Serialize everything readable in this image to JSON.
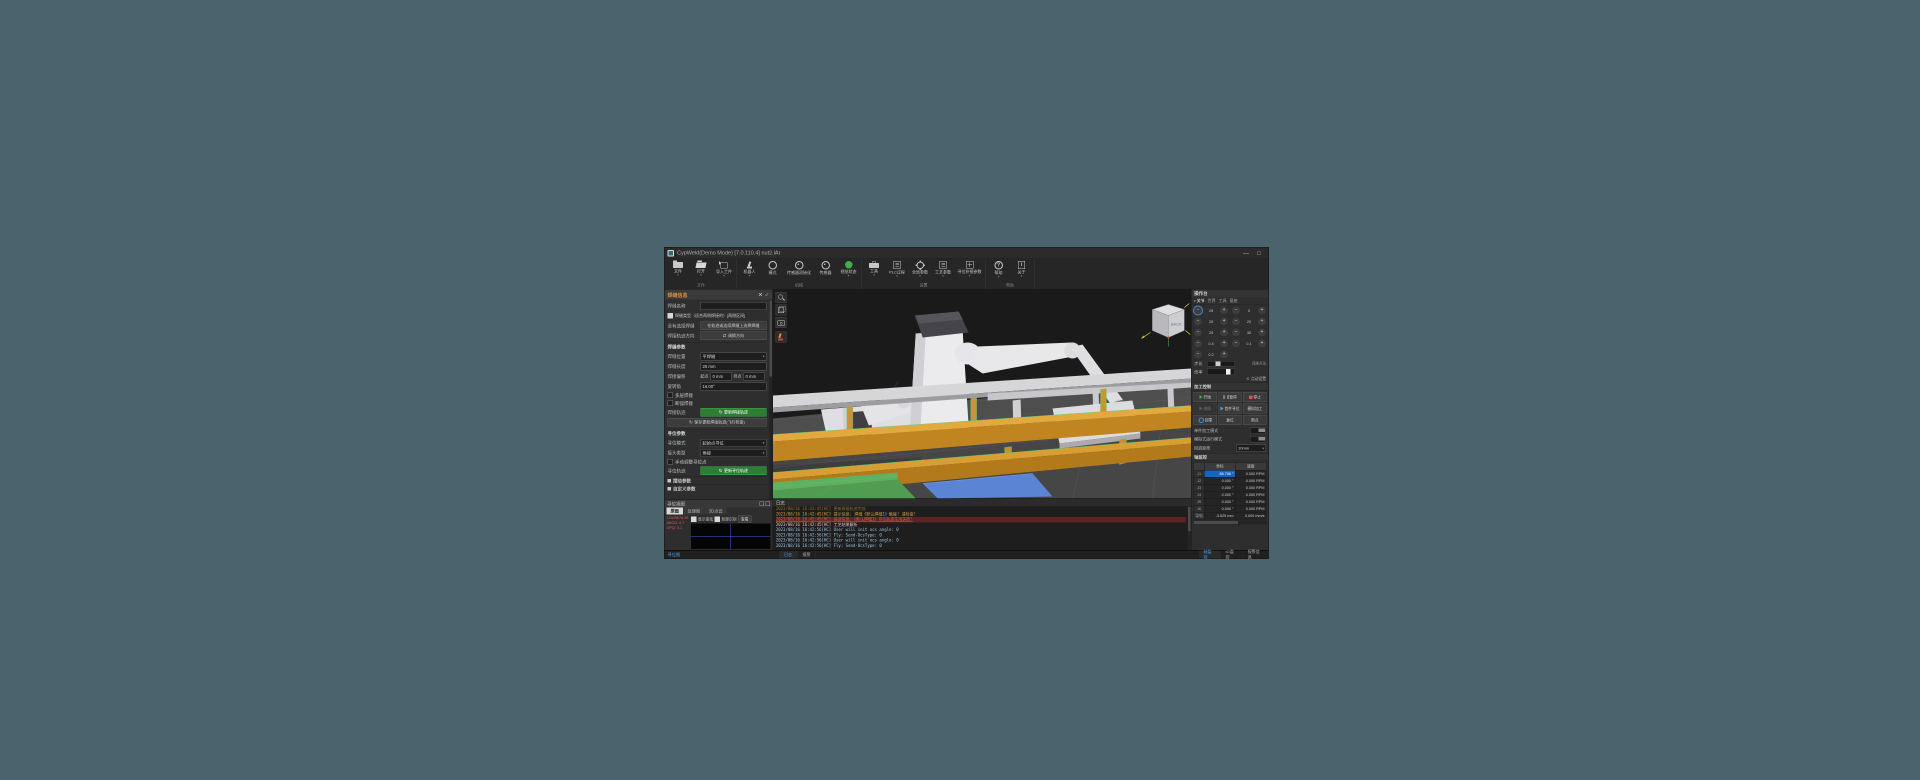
{
  "colors": {
    "desktop_bg": "#4b636d",
    "accent_green": "#3fae4a",
    "stop_red": "#d9534f",
    "panel_header_orange": "#d78d3c",
    "selected_cell_blue": "#1565c0",
    "tab_active_blue": "#4da3ff",
    "log_orange": "#d99b3c",
    "log_red": "#e05a52",
    "log_blue": "#9fc4e0",
    "workpiece_orange": "#c9892b",
    "panel_green": "#4f9c52",
    "panel_blue": "#5c84d4"
  },
  "window": {
    "title": "CypWeld(Demo Mode)  [7.0.110.4]  nut2.lAr",
    "minimize_glyph": "—",
    "maximize_glyph": "□"
  },
  "toolbar": {
    "groups": [
      {
        "label": "文件",
        "items": [
          {
            "label": "文件",
            "icon": "folder",
            "caret": true
          },
          {
            "label": "打开",
            "icon": "open",
            "caret": true
          },
          {
            "label": "导入工件",
            "icon": "import",
            "caret": true
          }
        ]
      },
      {
        "label": "机械",
        "items": [
          {
            "label": "机器人",
            "icon": "robot",
            "caret": true
          },
          {
            "label": "模式",
            "icon": "mode",
            "caret": false
          },
          {
            "label": "传感器初始化",
            "icon": "sensor",
            "caret": false
          },
          {
            "label": "传感器",
            "icon": "sensor2",
            "caret": false
          },
          {
            "label": "视觉状态",
            "icon": "status",
            "caret": true
          }
        ]
      },
      {
        "label": "设置",
        "items": [
          {
            "label": "工具",
            "icon": "case",
            "caret": true
          },
          {
            "label": "PLC过程",
            "icon": "doc",
            "caret": true
          },
          {
            "label": "全局参数",
            "icon": "gear",
            "caret": true
          },
          {
            "label": "工艺参数",
            "icon": "sheet",
            "caret": true
          },
          {
            "label": "寻位补偿参数",
            "icon": "comp",
            "caret": true
          }
        ]
      },
      {
        "label": "帮助",
        "items": [
          {
            "label": "帮助",
            "icon": "help",
            "caret": true
          },
          {
            "label": "关于",
            "icon": "about",
            "caret": true
          }
        ]
      }
    ]
  },
  "seam_panel": {
    "header": "焊缝信息",
    "close_glyph": "✕",
    "confirm_glyph": "✔",
    "name_label": "焊缝名称",
    "name_value": "",
    "type_check_label": "焊缝类型（适合两侧焊接的）[两侧区间]",
    "type_checked": true,
    "select_label": "没有选择焊缝",
    "select_button": "在轨迹或连续焊缝上选择焊缝",
    "dir_label": "焊接轨迹方向",
    "dir_button": "调换方向",
    "swap_glyph": "⇄",
    "sec_weld": "焊缝参数",
    "pos_label": "焊缝位置",
    "pos_value": "平焊缝",
    "len_label": "焊缝长度",
    "len_value": "25 mm",
    "offset_label": "焊接偏移",
    "offset_start_label": "起点",
    "offset_start_value": "0 mm",
    "offset_end_label": "终点",
    "offset_end_value": "0 mm",
    "angle_label": "旋转角",
    "angle_value": "16.00°",
    "chk_multilayer": "多层焊接",
    "chk_arc": "断弧焊接",
    "track_label": "焊接轨迹",
    "track_button": "更新焊接轨迹",
    "wide_button": "保存更新焊接轨迹(飞行检查)",
    "refresh_glyph": "↻",
    "sec_locate": "寻位参数",
    "mode_label": "寻位模式",
    "mode_value": "起始点寻位",
    "joint_label": "接头类型",
    "joint_value": "角接",
    "chk_manual": "手动调整寻位点",
    "locate_label": "寻位轨迹",
    "locate_button": "更新寻位轨迹",
    "collapsed": [
      "摆动参数",
      "自定义参数"
    ]
  },
  "vision_panel": {
    "header": "寻位视图",
    "tabs": {
      "items": [
        "原图",
        "处理图",
        "3D点云"
      ],
      "active": 0
    },
    "red_lines": [
      "12345678.99",
      "ABCD: 4.7",
      "OPQ: 3.1"
    ],
    "chk_show": "显示查找",
    "chk_contour": "轮廓识别",
    "view_button": "查看"
  },
  "viewport": {
    "cube_label": "BACK",
    "tools": [
      "zoom",
      "view-cube",
      "camera",
      "robot-tool"
    ]
  },
  "log_panel": {
    "header": "日志",
    "lines": [
      {
        "text": "2023/08/16 16:42:45[HC] 更新焊接轨迹完成",
        "color": "dimorange",
        "selected": false
      },
      {
        "text": "2023/08/16 16:42:45[HC] 提示信息: 焊缝《默认焊缝1》触碰! 请检查!",
        "color": "orange",
        "selected": false
      },
      {
        "text": "2023/08/16 16:42:45[HC] 错误信息:《默认焊缝1》寻位轨迹生成失败!",
        "color": "red",
        "selected": true
      },
      {
        "text": "2023/08/16 16:42:45[HC] 工艺结果解析",
        "color": "white",
        "selected": false
      },
      {
        "text": "2023/08/16 16:42:56[HC] User will init ocs angle: 0",
        "color": "blue",
        "selected": false
      },
      {
        "text": "2023/08/16 16:42:56[HC] Fly: Send-OcsType: 0",
        "color": "blue",
        "selected": false
      },
      {
        "text": "2023/08/16 16:42:56[HC] User will init ocs angle: 0",
        "color": "blue",
        "selected": false
      },
      {
        "text": "2023/08/16 16:42:56[HC] Fly: Send-OcsType: 0",
        "color": "blue",
        "selected": false
      }
    ]
  },
  "right_panel": {
    "header": "操作台",
    "mode_tabs": {
      "items": [
        "关节",
        "世界",
        "工具",
        "基座"
      ],
      "active": 0
    },
    "jog": {
      "minus": "−",
      "plus": "+",
      "pairs": [
        [
          "25",
          "0"
        ],
        [
          "20",
          "20"
        ],
        [
          "25",
          "30"
        ],
        [
          "0.4",
          "0.1"
        ],
        [
          "0.2",
          null
        ]
      ]
    },
    "step_label": "步长",
    "step_hint": "连续点动",
    "rate_label": "倍率",
    "jog_settings_glyph": "⊙",
    "jog_settings": "点动设置",
    "sec_control": "加工控制",
    "control_rows": [
      [
        {
          "label": "开始",
          "icon": "play",
          "dim": false
        },
        {
          "label": "暂停",
          "icon": "pause",
          "dim": false
        },
        {
          "label": "停止",
          "icon": "stop",
          "dim": false
        }
      ],
      [
        {
          "label": "继续",
          "icon": "play-dim",
          "dim": true
        },
        {
          "label": "首件寻位",
          "icon": "play-blue",
          "dim": false
        },
        {
          "label": "模拟加工",
          "icon": "none",
          "dim": false
        }
      ],
      [
        {
          "label": "回零",
          "icon": "home",
          "dim": false
        },
        {
          "label": "复位",
          "icon": "none",
          "dim": false
        },
        {
          "label": "断点",
          "icon": "none",
          "dim": false
        }
      ]
    ],
    "toggles": [
      "单件加工模式",
      "模拟式运行模式"
    ],
    "backoff_label": "回退距离",
    "backoff_value": "10mm",
    "sec_axis": "轴监控",
    "table": {
      "headers": [
        "坐标",
        "速度"
      ],
      "rows": [
        {
          "axis": "J1",
          "coord": "85.706 °",
          "speed": "0.000 RPM",
          "hl": true
        },
        {
          "axis": "J2",
          "coord": "0.000 °",
          "speed": "0.000 RPM",
          "hl": false
        },
        {
          "axis": "J3",
          "coord": "0.000 °",
          "speed": "0.000 RPM",
          "hl": false
        },
        {
          "axis": "J4",
          "coord": "0.000 °",
          "speed": "0.000 RPM",
          "hl": false
        },
        {
          "axis": "J5",
          "coord": "0.000 °",
          "speed": "0.000 RPM",
          "hl": false
        },
        {
          "axis": "J6",
          "coord": "0.000 °",
          "speed": "0.000 RPM",
          "hl": false
        },
        {
          "axis": "导轨",
          "coord": "-3.525 mm",
          "speed": "0.000 mm/s",
          "hl": false
        }
      ]
    }
  },
  "status_bar": {
    "left_label": "寻位图",
    "log_tabs": {
      "items": [
        "日志",
        "报警"
      ],
      "active": 0
    },
    "right_tabs": {
      "items": [
        "轴监控",
        "IO监控",
        "报警信息"
      ],
      "active": 0
    }
  }
}
